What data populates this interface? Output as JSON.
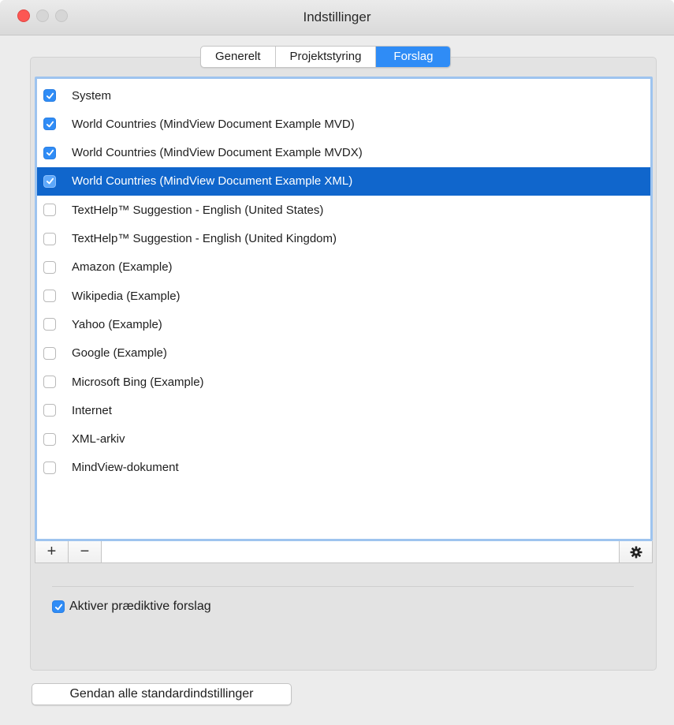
{
  "window": {
    "title": "Indstillinger"
  },
  "tabs": [
    {
      "label": "Generelt",
      "active": false
    },
    {
      "label": "Projektstyring",
      "active": false
    },
    {
      "label": "Forslag",
      "active": true
    }
  ],
  "sources": [
    {
      "label": "System",
      "checked": true,
      "selected": false
    },
    {
      "label": "World Countries (MindView Document Example MVD)",
      "checked": true,
      "selected": false
    },
    {
      "label": "World Countries (MindView Document Example MVDX)",
      "checked": true,
      "selected": false
    },
    {
      "label": "World Countries (MindView Document Example XML)",
      "checked": true,
      "selected": true
    },
    {
      "label": "TextHelp™ Suggestion - English (United States)",
      "checked": false,
      "selected": false
    },
    {
      "label": "TextHelp™ Suggestion - English (United Kingdom)",
      "checked": false,
      "selected": false
    },
    {
      "label": "Amazon (Example)",
      "checked": false,
      "selected": false
    },
    {
      "label": "Wikipedia (Example)",
      "checked": false,
      "selected": false
    },
    {
      "label": "Yahoo (Example)",
      "checked": false,
      "selected": false
    },
    {
      "label": "Google (Example)",
      "checked": false,
      "selected": false
    },
    {
      "label": "Microsoft Bing (Example)",
      "checked": false,
      "selected": false
    },
    {
      "label": "Internet",
      "checked": false,
      "selected": false
    },
    {
      "label": "XML-arkiv",
      "checked": false,
      "selected": false
    },
    {
      "label": "MindView-dokument",
      "checked": false,
      "selected": false
    }
  ],
  "list_toolbar": {
    "add_label": "+",
    "remove_label": "−",
    "settings_icon": "gear-icon"
  },
  "predictive": {
    "label": "Aktiver prædiktive forslag",
    "checked": true
  },
  "restore_button": {
    "label": "Gendan alle standardindstillinger"
  },
  "colors": {
    "accent": "#2f8cf6",
    "selection": "#1066cc",
    "close": "#fc5753"
  }
}
